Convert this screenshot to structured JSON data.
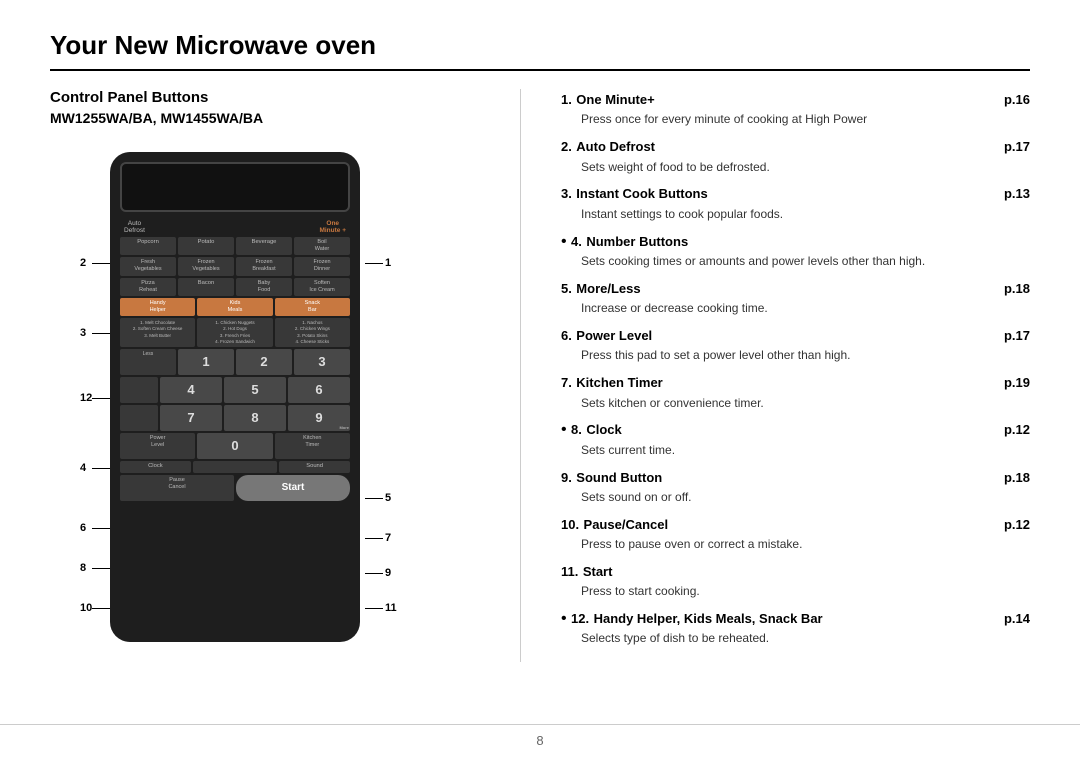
{
  "page": {
    "title": "Your New Microwave oven",
    "footer_page": "8"
  },
  "left": {
    "section_title": "Control Panel Buttons",
    "model_number": "MW1255WA/BA, MW1455WA/BA",
    "diagram_labels": {
      "label1": "1",
      "label2": "2",
      "label3": "3",
      "label4": "4",
      "label5": "5",
      "label6": "6",
      "label7": "7",
      "label8": "8",
      "label9": "9",
      "label10": "10",
      "label11": "11",
      "label12": "12"
    },
    "one_minute_label": "One\nMinute +",
    "auto_defrost_label": "Auto\nDefrost"
  },
  "microwave_buttons": {
    "row1": [
      "Popcorn",
      "Potato",
      "Beverage",
      "Boil\nWater"
    ],
    "row2": [
      "Fresh\nVegetables",
      "Frozen\nVegetables",
      "Frozen\nBreakfast",
      "Frozen\nDinner"
    ],
    "row3": [
      "Pizza\nReheat",
      "Bacon",
      "Baby\nFood",
      "Soften\nIce Cream"
    ],
    "row4_labels": [
      "Handy\nHelper",
      "Kids\nMeals",
      "Snack\nBar"
    ],
    "row4_sublists": [
      "1. Melt Chocolate\n2. Soften Cream Cheese\n3. Melt Butter",
      "1. Chicken Nuggets\n2. Hot Dogs\n3. French Fries\n4. Frozen Sandwich",
      "1. Nachos\n2. Chicken Wings\n3. Potato Skins\n4. Cheese Sticks"
    ],
    "numbers": [
      "1",
      "2",
      "3",
      "4",
      "5",
      "6",
      "7",
      "8",
      "9"
    ],
    "less_label": "Less",
    "more_label": "More",
    "zero": "0",
    "power_level": "Power\nLevel",
    "kitchen_timer": "Kitchen\nTimer",
    "clock": "Clock",
    "sound": "Sound",
    "pause_cancel": "Pause\nCancel",
    "start": "Start"
  },
  "right": {
    "items": [
      {
        "number": "1.",
        "title": "One Minute+",
        "page": "p.16",
        "desc": "Press once for every minute of cooking at High Power",
        "bullet": false
      },
      {
        "number": "2.",
        "title": "Auto Defrost",
        "page": "p.17",
        "desc": "Sets weight of food to be defrosted.",
        "bullet": false
      },
      {
        "number": "3.",
        "title": "Instant Cook Buttons",
        "page": "p.13",
        "desc": "Instant settings to cook popular foods.",
        "bullet": false
      },
      {
        "number": "4.",
        "title": "Number Buttons",
        "page": "",
        "desc": "Sets cooking times or amounts and power levels other than high.",
        "bullet": true
      },
      {
        "number": "5.",
        "title": "More/Less",
        "page": "p.18",
        "desc": "Increase or decrease cooking time.",
        "bullet": false
      },
      {
        "number": "6.",
        "title": "Power Level",
        "page": "p.17",
        "desc": "Press this pad to set a power level other than high.",
        "bullet": false
      },
      {
        "number": "7.",
        "title": "Kitchen Timer",
        "page": "p.19",
        "desc": "Sets kitchen or convenience timer.",
        "bullet": false
      },
      {
        "number": "8.",
        "title": "Clock",
        "page": "p.12",
        "desc": "Sets current time.",
        "bullet": true
      },
      {
        "number": "9.",
        "title": "Sound Button",
        "page": "p.18",
        "desc": "Sets sound on or off.",
        "bullet": false
      },
      {
        "number": "10.",
        "title": "Pause/Cancel",
        "page": "p.12",
        "desc": "Press to pause oven or correct a mistake.",
        "bullet": false
      },
      {
        "number": "11.",
        "title": "Start",
        "page": "",
        "desc": "Press to start cooking.",
        "bullet": false
      },
      {
        "number": "12.",
        "title": "Handy Helper, Kids Meals, Snack Bar",
        "page": "p.14",
        "desc": "Selects type of dish to be reheated.",
        "bullet": true
      }
    ]
  }
}
